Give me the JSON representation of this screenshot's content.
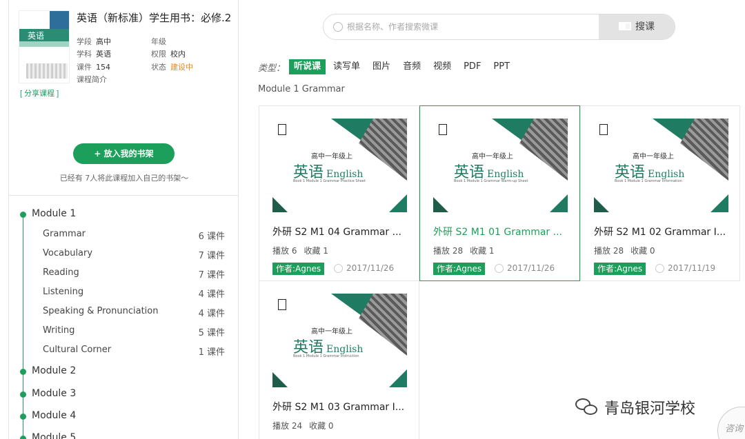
{
  "course": {
    "title": "英语（新标准）学生用书：必修.2",
    "cover_title": "英语",
    "share_label": "[ 分享课程 ]",
    "meta": [
      {
        "label": "学段",
        "value": "高中"
      },
      {
        "label": "年级",
        "value": ""
      },
      {
        "label": "学科",
        "value": "英语"
      },
      {
        "label": "权限",
        "value": "校内"
      },
      {
        "label": "课件",
        "value": "154"
      },
      {
        "label": "状态",
        "value": "建设中"
      }
    ],
    "intro_label": "课程简介",
    "shelf_button": "+ 放入我的书架",
    "shelf_note": "已经有 7人将此课程加入自己的书架～"
  },
  "tree": {
    "modules": [
      {
        "label": "Module 1",
        "lessons": [
          {
            "name": "Grammar",
            "count": "6 课件"
          },
          {
            "name": "Vocabulary",
            "count": "7 课件"
          },
          {
            "name": "Reading",
            "count": "7 课件"
          },
          {
            "name": "Listening",
            "count": "4 课件"
          },
          {
            "name": "Speaking & Pronunciation",
            "count": "4 课件"
          },
          {
            "name": "Writing",
            "count": "5 课件"
          },
          {
            "name": "Cultural Corner",
            "count": "1 课件"
          }
        ]
      },
      {
        "label": "Module 2"
      },
      {
        "label": "Module 3"
      },
      {
        "label": "Module 4"
      },
      {
        "label": "Module 5"
      }
    ]
  },
  "search": {
    "placeholder": "根据名称、作者搜索微课",
    "button": "搜课"
  },
  "filters": {
    "label": "类型：",
    "options": [
      "听说课",
      "读写单",
      "图片",
      "音频",
      "视频",
      "PDF",
      "PPT"
    ],
    "active": "听说课"
  },
  "breadcrumb": "Module 1  Grammar",
  "thumbnail": {
    "grade": "高中一年级上",
    "subject": "英语",
    "subject_en": "English"
  },
  "cards": [
    {
      "title": "外研 S2 M1 04 Grammar ...",
      "plays": "播放 6",
      "favs": "收藏 1",
      "author": "作者:Agnes",
      "date": "2017/11/26",
      "sub": "Book 1 Module 1 Grammar Practice Sheet"
    },
    {
      "title": "外研 S2 M1 01 Grammar ...",
      "plays": "播放 28",
      "favs": "收藏 1",
      "author": "作者:Agnes",
      "date": "2017/11/26",
      "sub": "Book 1 Module 1 Grammar Warm-up Sheet"
    },
    {
      "title": "外研 S2 M1 02 Grammar I...",
      "plays": "播放 28",
      "favs": "收藏 0",
      "author": "作者:Agnes",
      "date": "2017/11/19",
      "sub": "Book 1 Module 1 Grammar Information"
    },
    {
      "title": "外研 S2 M1 03 Grammar I...",
      "plays": "播放 24",
      "favs": "收藏 0",
      "author": "",
      "date": "",
      "sub": "Book 1 Module 1 Grammar Instruction"
    }
  ],
  "watermark": "青岛银河学校",
  "consult": "咨询"
}
